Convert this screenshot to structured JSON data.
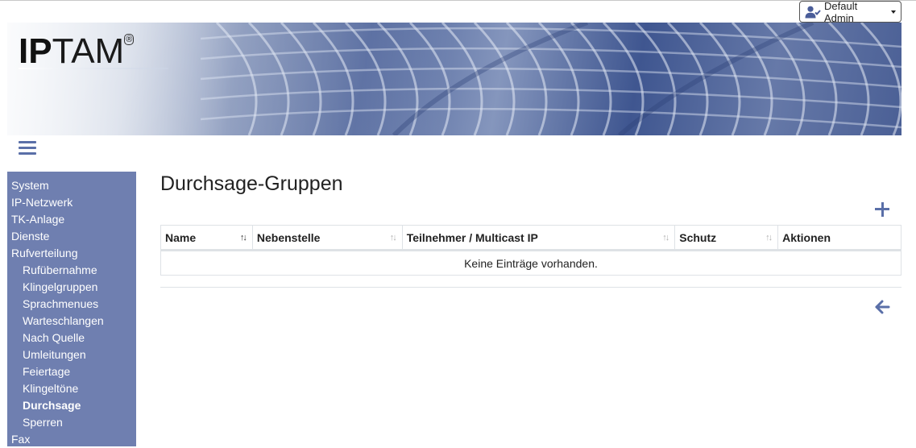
{
  "user": {
    "name": "Default Admin",
    "icon": "user-check-icon"
  },
  "brand": {
    "logo_ip": "IP",
    "logo_tam": "TAM",
    "logo_reg": "®"
  },
  "sidebar": {
    "items": [
      {
        "label": "System",
        "level": 0,
        "active": false
      },
      {
        "label": "IP-Netzwerk",
        "level": 0,
        "active": false
      },
      {
        "label": "TK-Anlage",
        "level": 0,
        "active": false
      },
      {
        "label": "Dienste",
        "level": 0,
        "active": false
      },
      {
        "label": "Rufverteilung",
        "level": 0,
        "active": false
      },
      {
        "label": "Rufübernahme",
        "level": 1,
        "active": false
      },
      {
        "label": "Klingelgruppen",
        "level": 1,
        "active": false
      },
      {
        "label": "Sprachmenues",
        "level": 1,
        "active": false
      },
      {
        "label": "Warteschlangen",
        "level": 1,
        "active": false
      },
      {
        "label": "Nach Quelle",
        "level": 1,
        "active": false
      },
      {
        "label": "Umleitungen",
        "level": 1,
        "active": false
      },
      {
        "label": "Feiertage",
        "level": 1,
        "active": false
      },
      {
        "label": "Klingeltöne",
        "level": 1,
        "active": false
      },
      {
        "label": "Durchsage",
        "level": 1,
        "active": true
      },
      {
        "label": "Sperren",
        "level": 1,
        "active": false
      },
      {
        "label": "Fax",
        "level": 0,
        "active": false
      }
    ]
  },
  "main": {
    "title": "Durchsage-Gruppen",
    "table": {
      "columns": [
        {
          "label": "Name",
          "sort_icon": "↑↓",
          "sort_active": true
        },
        {
          "label": "Nebenstelle",
          "sort_icon": "↑↓",
          "sort_active": false
        },
        {
          "label": "Teilnehmer / Multicast IP",
          "sort_icon": "↑↓",
          "sort_active": false
        },
        {
          "label": "Schutz",
          "sort_icon": "↑↓",
          "sort_active": false
        },
        {
          "label": "Aktionen",
          "sort_icon": "",
          "sort_active": false
        }
      ],
      "empty_message": "Keine Einträge vorhanden."
    }
  },
  "colors": {
    "accent": "#5a6fa8",
    "sidebar_bg": "#6f7fb0"
  }
}
